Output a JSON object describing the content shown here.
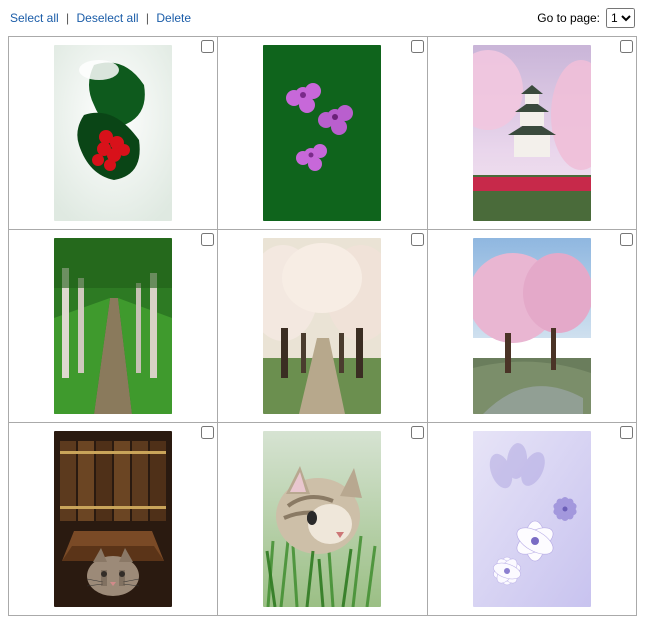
{
  "toolbar": {
    "select_all": "Select all",
    "deselect_all": "Deselect all",
    "delete": "Delete",
    "sep": "|",
    "go_to_page": "Go to page:",
    "page_options": [
      "1"
    ],
    "page_selected": "1"
  },
  "grid": {
    "items": [
      {
        "name": "holly-berries",
        "checked": false
      },
      {
        "name": "purple-flowers",
        "checked": false
      },
      {
        "name": "japanese-castle",
        "checked": false
      },
      {
        "name": "forest-path",
        "checked": false
      },
      {
        "name": "blossom-avenue",
        "checked": false
      },
      {
        "name": "riverside-blossom",
        "checked": false
      },
      {
        "name": "cat-books",
        "checked": false
      },
      {
        "name": "cat-grass",
        "checked": false
      },
      {
        "name": "lilac-flowers",
        "checked": false
      }
    ]
  }
}
